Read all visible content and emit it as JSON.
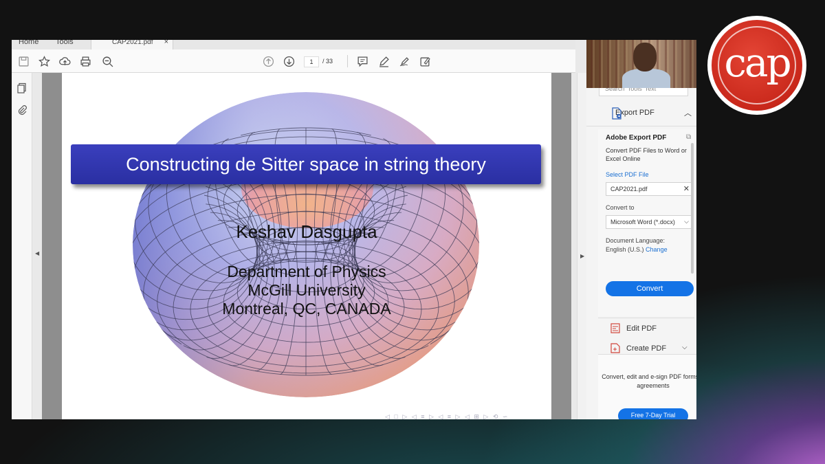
{
  "tabs": {
    "home": "Home",
    "tools": "Tools",
    "file": "CAP2021.pdf",
    "close": "×"
  },
  "toolbar": {
    "page_current": "1",
    "page_total": "/ 33"
  },
  "slide": {
    "title": "Constructing de Sitter space in string theory",
    "author": "Keshav Dasgupta",
    "affiliation": [
      "Department of Physics",
      "McGill University",
      "Montreal, QC, CANADA"
    ]
  },
  "panel": {
    "search_placeholder": "Search 'Tools' Text",
    "export_pdf": "Export PDF",
    "export_title": "Adobe Export PDF",
    "export_desc": "Convert PDF Files to Word or Excel Online",
    "select_label": "Select PDF File",
    "selected_file": "CAP2021.pdf",
    "convert_to_label": "Convert to",
    "convert_to_value": "Microsoft Word (*.docx)",
    "doc_language_label": "Document Language:",
    "doc_language_value": "English (U.S.)",
    "change_link": "Change",
    "convert_button": "Convert",
    "edit_pdf": "Edit PDF",
    "create_pdf": "Create PDF",
    "footer_text": "Convert, edit and e-sign PDF forms & agreements",
    "trial_button": "Free 7-Day Trial"
  },
  "logo": {
    "text": "cap",
    "color": "#c9281b"
  },
  "colors": {
    "banner": "#2f34ad",
    "accent": "#1473e6"
  }
}
